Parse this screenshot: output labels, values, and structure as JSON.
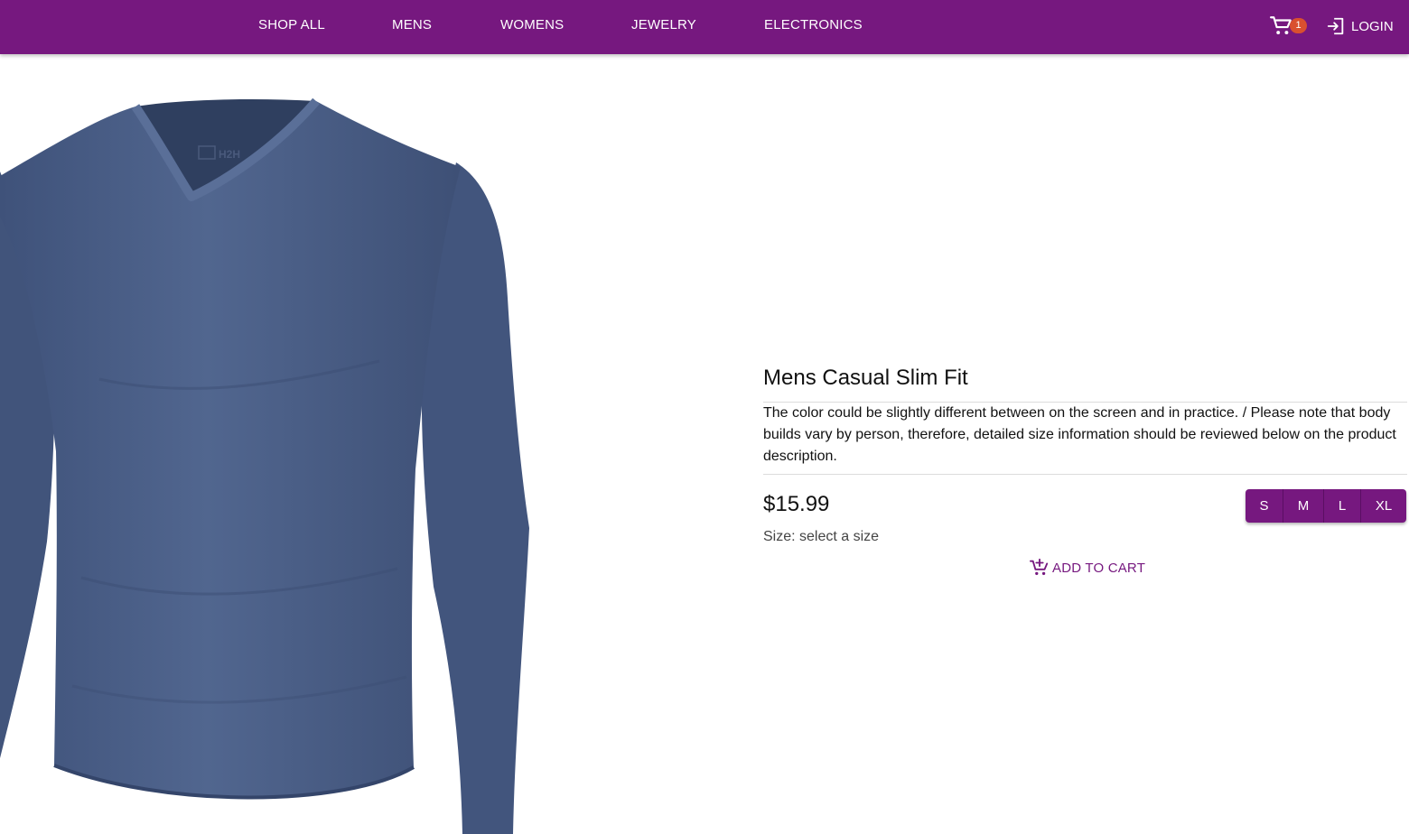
{
  "nav": {
    "links": [
      "SHOP ALL",
      "MENS",
      "WOMENS",
      "JEWELRY",
      "ELECTRONICS"
    ],
    "cart_count": "1",
    "login_label": "LOGIN"
  },
  "product": {
    "image_logo_text": "H2H",
    "title": "Mens Casual Slim Fit",
    "description": "The color could be slightly different between on the screen and in practice. / Please note that body builds vary by person, therefore, detailed size information should be reviewed below on the product description.",
    "price": "$15.99",
    "sizes": [
      "S",
      "M",
      "L",
      "XL"
    ],
    "size_status": "Size: select a size",
    "add_to_cart_label": "ADD TO CART",
    "shirt_color": "#4c6189"
  },
  "colors": {
    "brand": "#76187f",
    "badge": "#d9502f"
  },
  "icons": {
    "cart": "shopping-cart-icon",
    "login": "login-arrow-icon",
    "add_to_cart": "add-shopping-cart-icon"
  }
}
